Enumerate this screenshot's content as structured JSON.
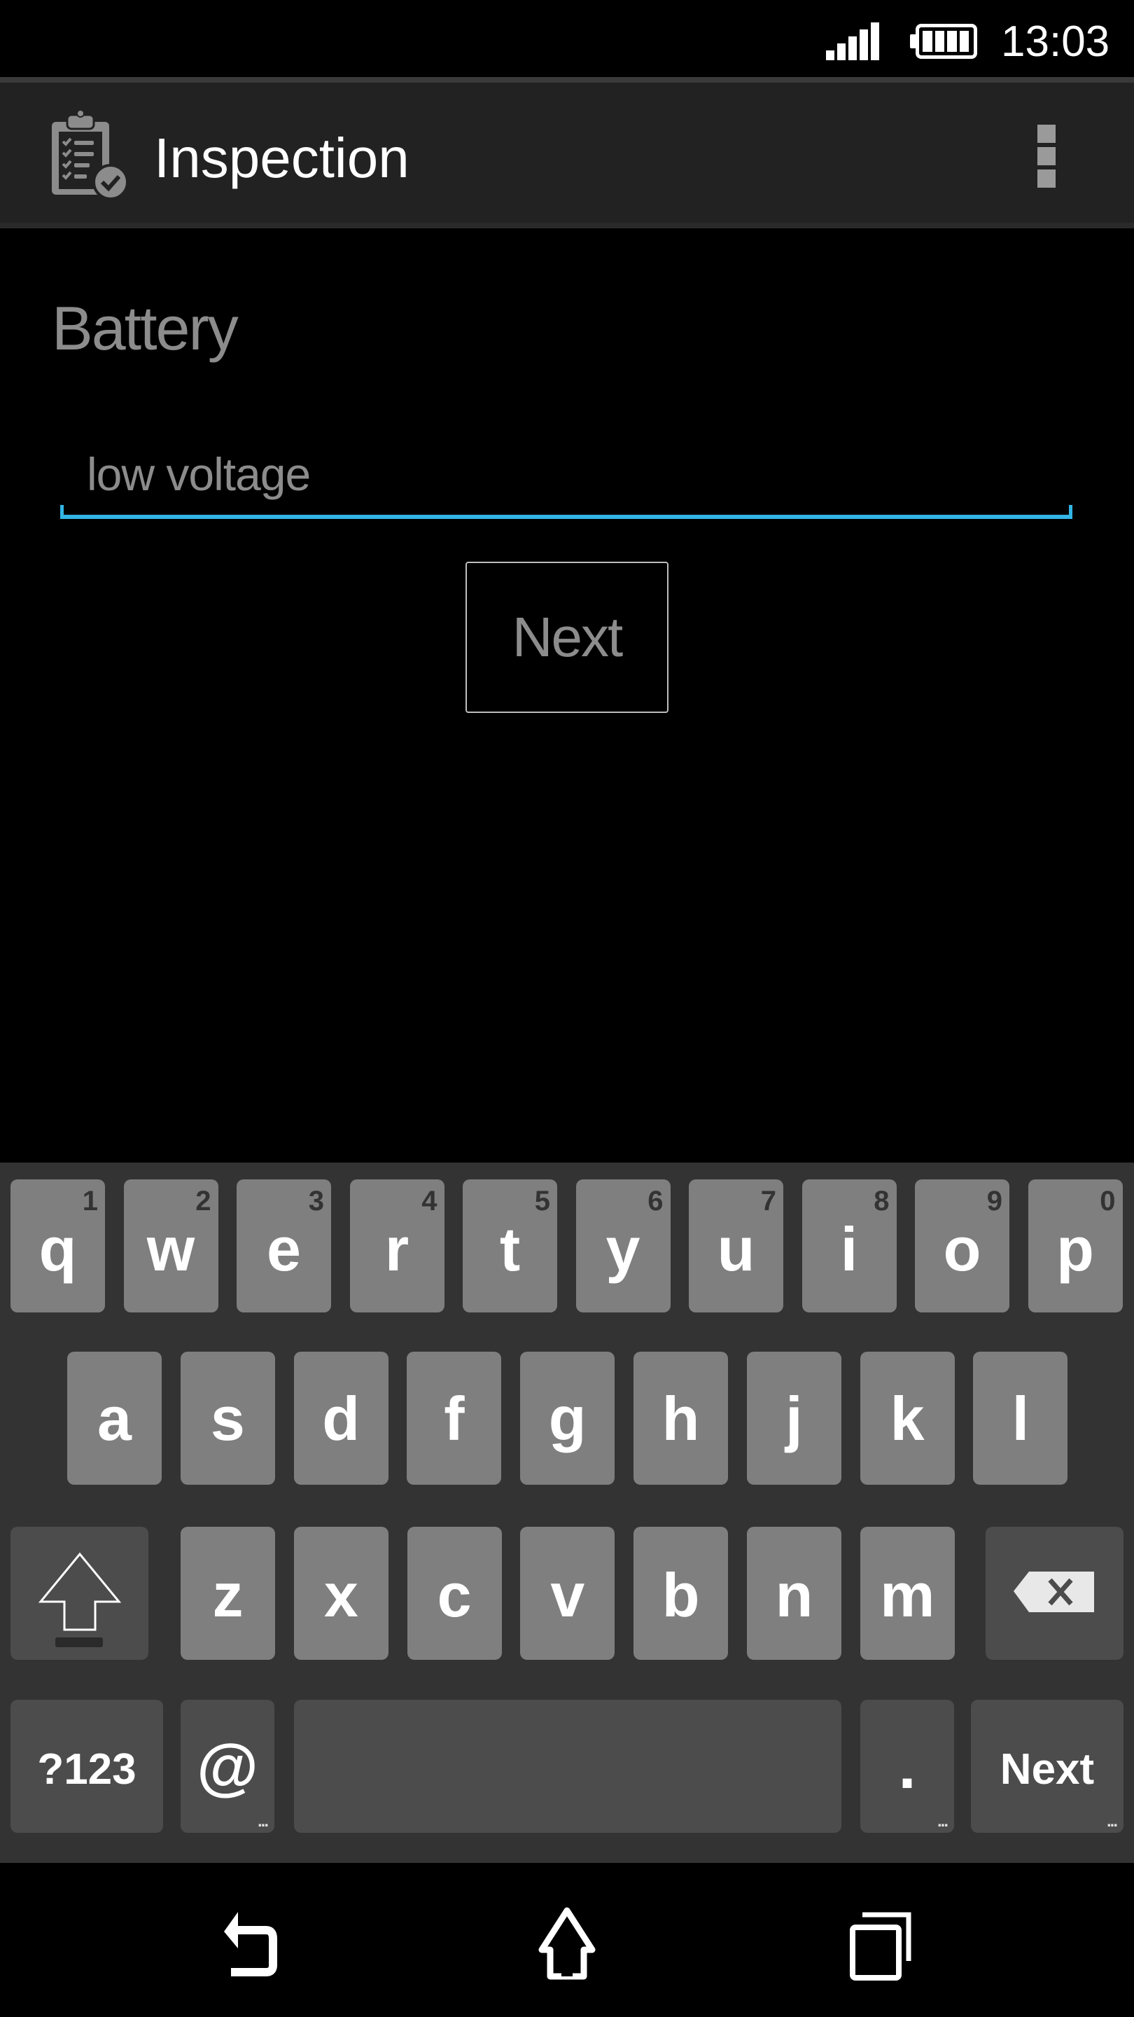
{
  "status_bar": {
    "time": "13:03",
    "signal_icon": "cell-signal-icon",
    "battery_icon": "battery-full-icon"
  },
  "app_bar": {
    "title": "Inspection",
    "app_icon": "clipboard-checklist-icon",
    "menu_icon": "overflow-menu-icon"
  },
  "form": {
    "label": "Battery",
    "input_value": "low voltage",
    "accent_color": "#33b5e5",
    "next_button_label": "Next"
  },
  "keyboard": {
    "row1": [
      {
        "key": "q",
        "hint": "1"
      },
      {
        "key": "w",
        "hint": "2"
      },
      {
        "key": "e",
        "hint": "3"
      },
      {
        "key": "r",
        "hint": "4"
      },
      {
        "key": "t",
        "hint": "5"
      },
      {
        "key": "y",
        "hint": "6"
      },
      {
        "key": "u",
        "hint": "7"
      },
      {
        "key": "i",
        "hint": "8"
      },
      {
        "key": "o",
        "hint": "9"
      },
      {
        "key": "p",
        "hint": "0"
      }
    ],
    "row2": [
      "a",
      "s",
      "d",
      "f",
      "g",
      "h",
      "j",
      "k",
      "l"
    ],
    "row3": [
      "z",
      "x",
      "c",
      "v",
      "b",
      "n",
      "m"
    ],
    "shift_icon": "shift-arrow-icon",
    "backspace_icon": "backspace-icon",
    "symbols_label": "?123",
    "at_label": "@",
    "period_label": ".",
    "action_label": "Next",
    "more_indicator": "..."
  },
  "nav_bar": {
    "back_icon": "back-icon",
    "home_icon": "home-icon",
    "recents_icon": "recent-apps-icon"
  }
}
